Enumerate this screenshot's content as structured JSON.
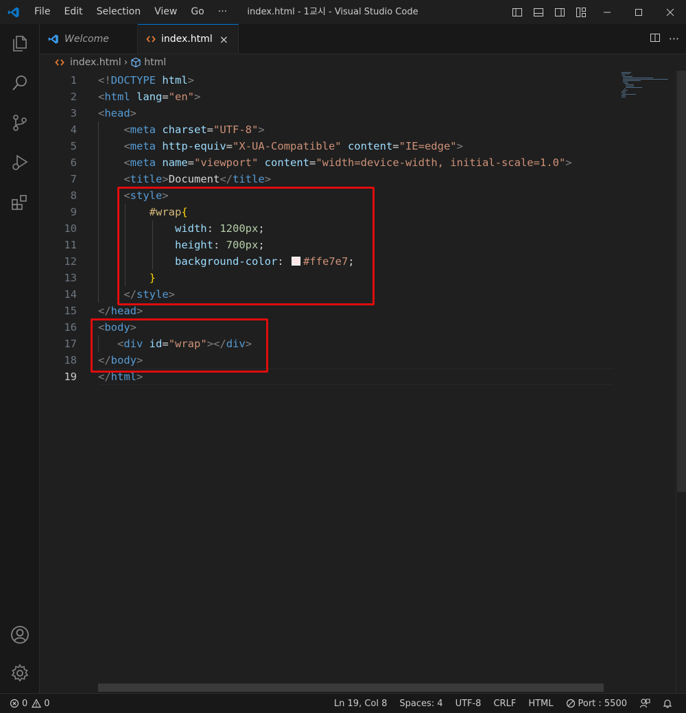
{
  "titlebar": {
    "menu": [
      "File",
      "Edit",
      "Selection",
      "View",
      "Go",
      "···"
    ],
    "window_title": "index.html - 1교시 - Visual Studio Code"
  },
  "tabs": [
    {
      "label": "Welcome",
      "active": false
    },
    {
      "label": "index.html",
      "active": true,
      "close": "×"
    }
  ],
  "breadcrumb": {
    "file": "index.html",
    "separator": "›",
    "symbol": "html"
  },
  "code_lines": [
    {
      "n": "1",
      "tokens": [
        [
          "br",
          "<!"
        ],
        [
          "tag",
          "DOCTYPE"
        ],
        [
          "attr",
          " html"
        ],
        [
          "br",
          ">"
        ]
      ]
    },
    {
      "n": "2",
      "tokens": [
        [
          "br",
          "<"
        ],
        [
          "tag",
          "html"
        ],
        [
          "attr",
          " lang"
        ],
        [
          "text",
          "="
        ],
        [
          "str",
          "\"en\""
        ],
        [
          "br",
          ">"
        ]
      ]
    },
    {
      "n": "3",
      "tokens": [
        [
          "br",
          "<"
        ],
        [
          "tag",
          "head"
        ],
        [
          "br",
          ">"
        ]
      ]
    },
    {
      "n": "4",
      "tokens": [
        [
          "text",
          "    "
        ],
        [
          "br",
          "<"
        ],
        [
          "tag",
          "meta"
        ],
        [
          "attr",
          " charset"
        ],
        [
          "text",
          "="
        ],
        [
          "str",
          "\"UTF-8\""
        ],
        [
          "br",
          ">"
        ]
      ]
    },
    {
      "n": "5",
      "tokens": [
        [
          "text",
          "    "
        ],
        [
          "br",
          "<"
        ],
        [
          "tag",
          "meta"
        ],
        [
          "attr",
          " http-equiv"
        ],
        [
          "text",
          "="
        ],
        [
          "str",
          "\"X-UA-Compatible\""
        ],
        [
          "attr",
          " content"
        ],
        [
          "text",
          "="
        ],
        [
          "str",
          "\"IE=edge\""
        ],
        [
          "br",
          ">"
        ]
      ]
    },
    {
      "n": "6",
      "tokens": [
        [
          "text",
          "    "
        ],
        [
          "br",
          "<"
        ],
        [
          "tag",
          "meta"
        ],
        [
          "attr",
          " name"
        ],
        [
          "text",
          "="
        ],
        [
          "str",
          "\"viewport\""
        ],
        [
          "attr",
          " content"
        ],
        [
          "text",
          "="
        ],
        [
          "str",
          "\"width=device-width, initial-scale=1.0\""
        ],
        [
          "br",
          ">"
        ]
      ]
    },
    {
      "n": "7",
      "tokens": [
        [
          "text",
          "    "
        ],
        [
          "br",
          "<"
        ],
        [
          "tag",
          "title"
        ],
        [
          "br",
          ">"
        ],
        [
          "text",
          "Document"
        ],
        [
          "br",
          "</"
        ],
        [
          "tag",
          "title"
        ],
        [
          "br",
          ">"
        ]
      ]
    },
    {
      "n": "8",
      "tokens": [
        [
          "text",
          "    "
        ],
        [
          "br",
          "<"
        ],
        [
          "tag",
          "style"
        ],
        [
          "br",
          ">"
        ]
      ]
    },
    {
      "n": "9",
      "tokens": [
        [
          "text",
          "        "
        ],
        [
          "sel",
          "#wrap"
        ],
        [
          "brace",
          "{"
        ]
      ]
    },
    {
      "n": "10",
      "tokens": [
        [
          "text",
          "            "
        ],
        [
          "prop",
          "width"
        ],
        [
          "text",
          ": "
        ],
        [
          "num",
          "1200px"
        ],
        [
          "text",
          ";"
        ]
      ]
    },
    {
      "n": "11",
      "tokens": [
        [
          "text",
          "            "
        ],
        [
          "prop",
          "height"
        ],
        [
          "text",
          ": "
        ],
        [
          "num",
          "700px"
        ],
        [
          "text",
          ";"
        ]
      ]
    },
    {
      "n": "12",
      "tokens": [
        [
          "text",
          "            "
        ],
        [
          "prop",
          "background-color"
        ],
        [
          "text",
          ": "
        ],
        [
          "swatch",
          "#ffe7e7"
        ],
        [
          "str",
          "#ffe7e7"
        ],
        [
          "text",
          ";"
        ]
      ]
    },
    {
      "n": "13",
      "tokens": [
        [
          "text",
          "        "
        ],
        [
          "brace",
          "}"
        ]
      ]
    },
    {
      "n": "14",
      "tokens": [
        [
          "text",
          "    "
        ],
        [
          "br",
          "</"
        ],
        [
          "tag",
          "style"
        ],
        [
          "br",
          ">"
        ]
      ]
    },
    {
      "n": "15",
      "tokens": [
        [
          "br",
          "</"
        ],
        [
          "tag",
          "head"
        ],
        [
          "br",
          ">"
        ]
      ]
    },
    {
      "n": "16",
      "tokens": [
        [
          "br",
          "<"
        ],
        [
          "tag",
          "body"
        ],
        [
          "br",
          ">"
        ]
      ]
    },
    {
      "n": "17",
      "tokens": [
        [
          "text",
          "   "
        ],
        [
          "br",
          "<"
        ],
        [
          "tag",
          "div"
        ],
        [
          "attr",
          " id"
        ],
        [
          "text",
          "="
        ],
        [
          "str",
          "\"wrap\""
        ],
        [
          "br",
          "></"
        ],
        [
          "tag",
          "div"
        ],
        [
          "br",
          ">"
        ]
      ]
    },
    {
      "n": "18",
      "tokens": [
        [
          "br",
          "</"
        ],
        [
          "tag",
          "body"
        ],
        [
          "br",
          ">"
        ]
      ]
    },
    {
      "n": "19",
      "tokens": [
        [
          "br",
          "</"
        ],
        [
          "tag",
          "html"
        ],
        [
          "br",
          ">"
        ]
      ]
    }
  ],
  "current_line": "19",
  "status": {
    "errors": "0",
    "warnings": "0",
    "position": "Ln 19, Col 8",
    "spaces": "Spaces: 4",
    "encoding": "UTF-8",
    "eol": "CRLF",
    "language": "HTML",
    "port": "Port : 5500"
  },
  "colors": {
    "accent": "#0078d4",
    "highlight_box": "#e00d0d",
    "swatch": "#ffe7e7"
  },
  "icons": [
    "vscode-logo-icon",
    "explorer-icon",
    "search-icon",
    "source-control-icon",
    "run-debug-icon",
    "extensions-icon",
    "account-icon",
    "settings-gear-icon"
  ]
}
